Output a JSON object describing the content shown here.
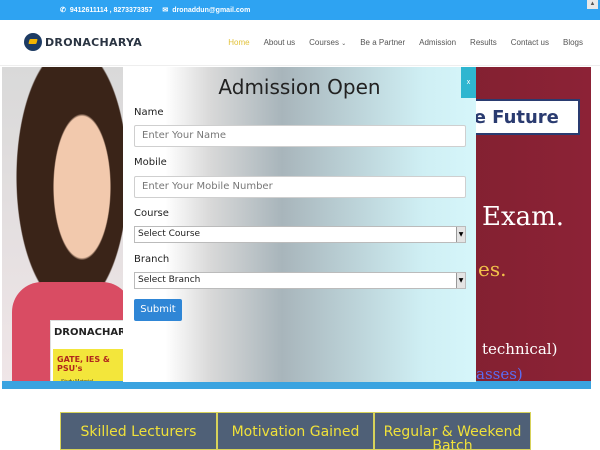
{
  "topbar": {
    "phone_icon": "phone-icon",
    "phones": "9412611114 , 8273373357",
    "mail_icon": "mail-icon",
    "email": "dronaddun@gmail.com"
  },
  "header": {
    "logo_text": "DRONACHARYA",
    "nav": [
      {
        "label": "Home"
      },
      {
        "label": "About us"
      },
      {
        "label": "Courses"
      },
      {
        "label": "Be a Partner"
      },
      {
        "label": "Admission"
      },
      {
        "label": "Results"
      },
      {
        "label": "Contact us"
      },
      {
        "label": "Blogs"
      }
    ],
    "active_color": "#e2c23a"
  },
  "hero": {
    "book_brand": "DRONACHARYA",
    "book_title": "GATE, IES & PSU's",
    "book_sub": "Study Material",
    "banner_title": "ure Future",
    "banner_line1": "Exam.",
    "banner_line2": "es.",
    "banner_line3": "technical)",
    "banner_line4": "asses)"
  },
  "modal": {
    "title": "Admission Open",
    "close_label": "x",
    "fields": {
      "name_label": "Name",
      "name_placeholder": "Enter Your Name",
      "mobile_label": "Mobile",
      "mobile_placeholder": "Enter Your Mobile Number",
      "course_label": "Course",
      "course_value": "Select Course",
      "branch_label": "Branch",
      "branch_value": "Select Branch"
    },
    "submit_label": "Submit"
  },
  "features": [
    {
      "label": "Skilled Lecturers"
    },
    {
      "label": "Motivation Gained"
    },
    {
      "label": "Regular & Weekend Batch"
    }
  ]
}
